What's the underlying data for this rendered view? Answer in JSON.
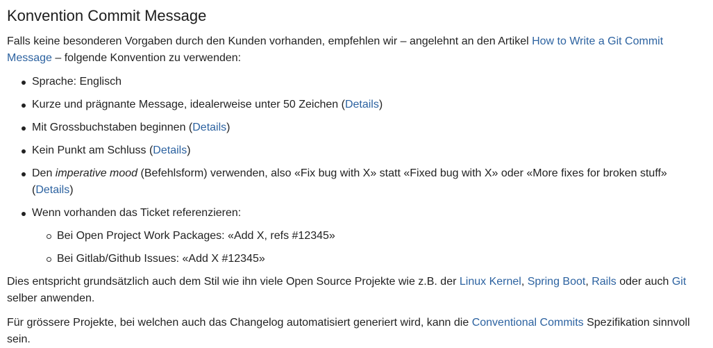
{
  "heading": "Konvention Commit Message",
  "intro": {
    "text_before": "Falls keine besonderen Vorgaben durch den Kunden vorhanden, empfehlen wir – angelehnt an den Artikel ",
    "link": "How to Write a Git Commit Message",
    "text_after": " – folgende Konvention zu verwenden:"
  },
  "list": {
    "item1": {
      "text": "Sprache: Englisch"
    },
    "item2": {
      "text": "Kurze und prägnante Message, idealerweise unter 50 Zeichen (",
      "link": "Details",
      "close": ")"
    },
    "item3": {
      "text": "Mit Grossbuchstaben beginnen (",
      "link": "Details",
      "close": ")"
    },
    "item4": {
      "text": "Kein Punkt am Schluss (",
      "link": "Details",
      "close": ")"
    },
    "item5": {
      "text_before": "Den ",
      "emphasis": "imperative mood",
      "text_after": " (Befehlsform) verwenden, also «Fix bug with X» statt «Fixed bug with X» oder «More fixes for broken stuff» (",
      "link": "Details",
      "close": ")"
    },
    "item6": {
      "text": "Wenn vorhanden das Ticket referenzieren:",
      "sub": {
        "a": "Bei Open Project Work Packages: «Add X, refs #12345»",
        "b": "Bei Gitlab/Github Issues: «Add X #12345»"
      }
    }
  },
  "para2": {
    "text_before": "Dies entspricht grundsätzlich auch dem Stil wie ihn viele Open Source Projekte wie z.B. der ",
    "link_linux": "Linux Kernel",
    "sep1": ", ",
    "link_spring": "Spring Boot",
    "sep2": ", ",
    "link_rails": "Rails",
    "mid": " oder auch ",
    "link_git": "Git",
    "text_after": " sel­ber anwenden."
  },
  "para3": {
    "text_before": "Für grössere Projekte, bei welchen auch das Changelog automatisiert generiert wird, kann die ",
    "link": "Conventional Commits",
    "text_after": " Spezifikation sinnvoll sein."
  },
  "colors": {
    "text": "#222222",
    "link": "#2c62a0",
    "background": "#ffffff"
  }
}
